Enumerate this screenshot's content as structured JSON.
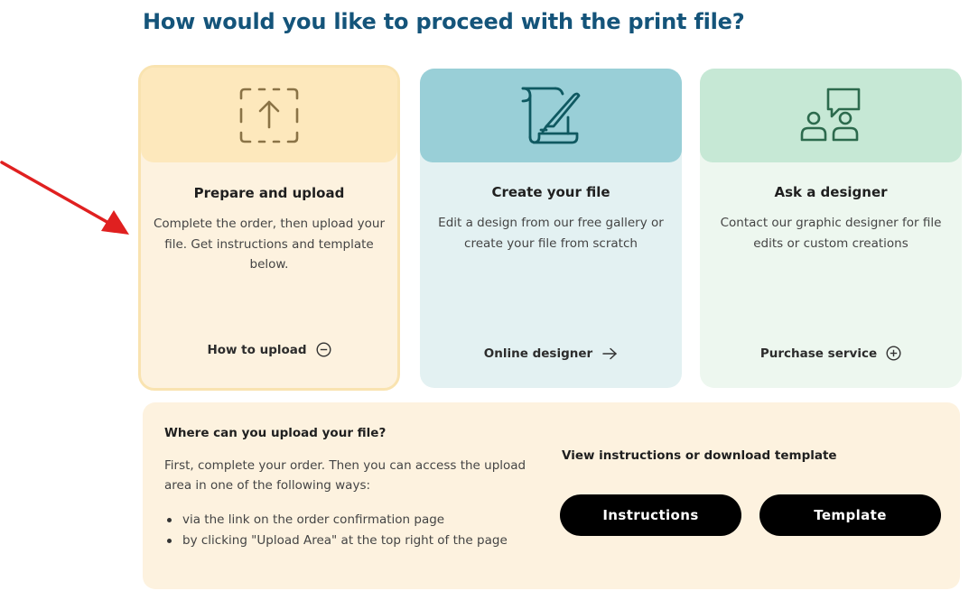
{
  "heading": "How would you like to proceed with the print file?",
  "cards": [
    {
      "icon": "upload-icon",
      "title": "Prepare and upload",
      "description": "Complete the order, then upload your file. Get instructions and template below.",
      "link_label": "How to upload",
      "link_icon": "collapse-circle-icon",
      "accent": "#fde8bc"
    },
    {
      "icon": "scroll-quill-icon",
      "title": "Create your file",
      "description": "Edit a design from our free gallery or create your file from scratch",
      "link_label": "Online designer",
      "link_icon": "arrow-right-icon",
      "accent": "#99cfd7"
    },
    {
      "icon": "designer-chat-icon",
      "title": "Ask a designer",
      "description": "Contact our graphic designer for file edits or custom creations",
      "link_label": "Purchase service",
      "link_icon": "plus-circle-icon",
      "accent": "#c6e8d5"
    }
  ],
  "upload_panel": {
    "title": "Where can you upload your file?",
    "text": "First, complete your order. Then you can access the upload area in one of the following ways:",
    "options": [
      "via the link on the order confirmation page",
      "by clicking \"Upload Area\" at the top right of the page"
    ],
    "right_title": "View instructions or download template",
    "instructions_button": "Instructions",
    "template_button": "Template"
  },
  "colors": {
    "heading": "#14547a",
    "annotation_arrow": "#e02020",
    "button_bg": "#000000"
  }
}
